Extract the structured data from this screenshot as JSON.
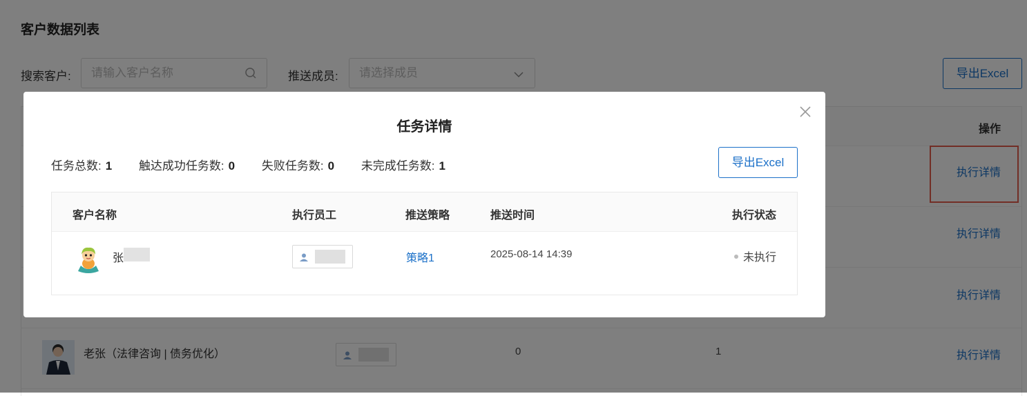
{
  "page": {
    "title": "客户数据列表",
    "search": {
      "label": "搜索客户:",
      "placeholder": "请输入客户名称"
    },
    "member": {
      "label": "推送成员:",
      "placeholder": "请选择成员"
    },
    "export_label": "导出Excel",
    "table": {
      "op_header": "操作",
      "rows": [
        {
          "link": "执行详情"
        },
        {
          "link": "执行详情"
        },
        {
          "link": "执行详情"
        },
        {
          "name": "老张（法律咨询 | 债务优化）",
          "col3": "0",
          "col4": "1",
          "link": "执行详情"
        }
      ]
    }
  },
  "modal": {
    "title": "任务详情",
    "stats": [
      {
        "label": "任务总数:",
        "value": "1"
      },
      {
        "label": "触达成功任务数:",
        "value": "0"
      },
      {
        "label": "失败任务数:",
        "value": "0"
      },
      {
        "label": "未完成任务数:",
        "value": "1"
      }
    ],
    "export_label": "导出Excel",
    "columns": [
      "客户名称",
      "执行员工",
      "推送策略",
      "推送时间",
      "执行状态"
    ],
    "row": {
      "customer": "张",
      "strategy": "策略1",
      "time": "2025-08-14 14:39",
      "status": "未执行"
    }
  },
  "colors": {
    "accent": "#1b70c8",
    "highlight": "#e45b4a",
    "overlay": "rgba(0,0,0,0.5)"
  }
}
